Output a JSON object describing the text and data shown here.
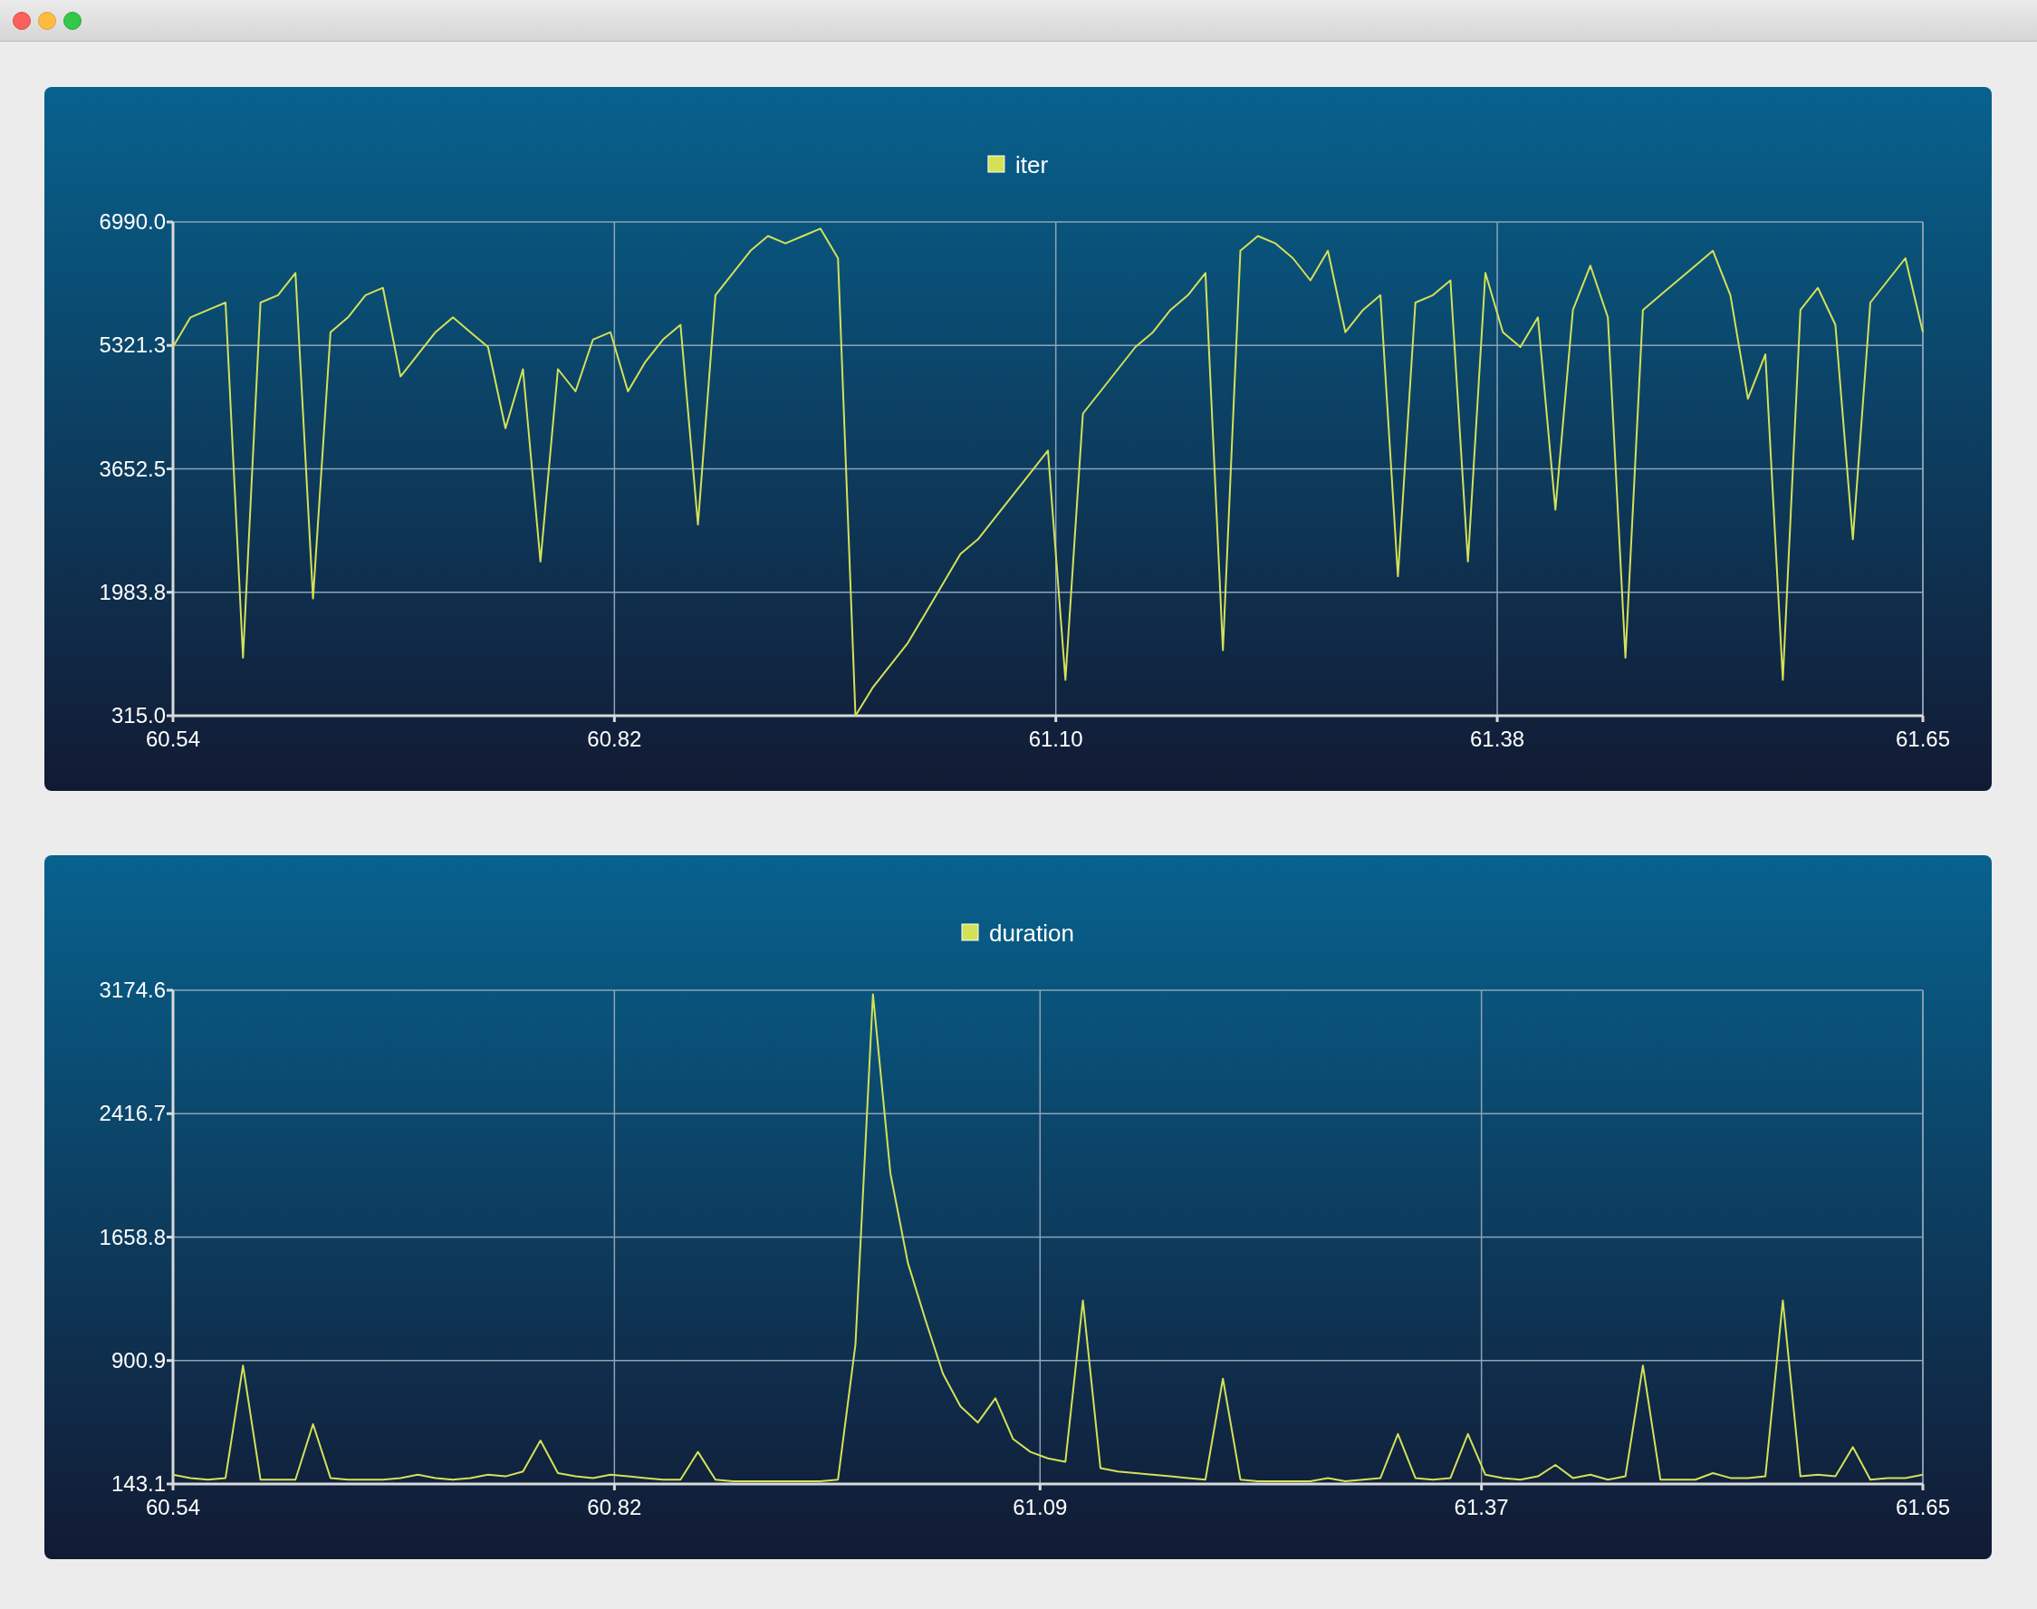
{
  "charts": [
    {
      "chart_data": {
        "type": "line",
        "grid": true,
        "x": [
          60.54,
          60.5511,
          60.5622,
          60.5733,
          60.5844,
          60.5955,
          60.6066,
          60.6177,
          60.6288,
          60.6399,
          60.651,
          60.6621,
          60.6732,
          60.6843,
          60.6954,
          60.7065,
          60.7176,
          60.7287,
          60.7398,
          60.7509,
          60.762,
          60.7731,
          60.7842,
          60.7953,
          60.8064,
          60.8175,
          60.8286,
          60.8397,
          60.8508,
          60.8619,
          60.873,
          60.8841,
          60.8952,
          60.9063,
          60.9174,
          60.9285,
          60.9396,
          60.9507,
          60.9618,
          60.9729,
          60.984,
          60.9951,
          61.0062,
          61.0173,
          61.0284,
          61.0395,
          61.0506,
          61.0617,
          61.0728,
          61.0839,
          61.095,
          61.1061,
          61.1172,
          61.1283,
          61.1394,
          61.1505,
          61.1616,
          61.1727,
          61.1838,
          61.1949,
          61.206,
          61.2171,
          61.2282,
          61.2393,
          61.2504,
          61.2615,
          61.2726,
          61.2837,
          61.2948,
          61.3059,
          61.317,
          61.3281,
          61.3392,
          61.3503,
          61.3614,
          61.3725,
          61.3836,
          61.3947,
          61.4058,
          61.4169,
          61.428,
          61.4391,
          61.4502,
          61.4613,
          61.4724,
          61.4835,
          61.4946,
          61.5057,
          61.5168,
          61.5279,
          61.539,
          61.5501,
          61.5612,
          61.5723,
          61.5834,
          61.5945,
          61.6056,
          61.6167,
          61.6278,
          61.6389,
          61.65
        ],
        "series": [
          {
            "name": "iter",
            "color": "#d4e157",
            "values": [
              5300,
              5700,
              5800,
              5900,
              1100,
              5900,
              6000,
              6300,
              1900,
              5500,
              5700,
              6000,
              6100,
              4900,
              5200,
              5500,
              5700,
              5500,
              5300,
              4200,
              5000,
              2400,
              5000,
              4700,
              5400,
              5500,
              4700,
              5100,
              5400,
              5600,
              2900,
              6000,
              6300,
              6600,
              6800,
              6700,
              6800,
              6900,
              6500,
              315,
              700,
              1000,
              1300,
              1700,
              2100,
              2500,
              2700,
              3000,
              3300,
              3600,
              3900,
              800,
              4400,
              4700,
              5000,
              5300,
              5500,
              5800,
              6000,
              6300,
              1200,
              6600,
              6800,
              6700,
              6500,
              6200,
              6600,
              5500,
              5800,
              6000,
              2200,
              5900,
              6000,
              6200,
              2400,
              6300,
              5500,
              5300,
              5700,
              3100,
              5800,
              6400,
              5700,
              1100,
              5800,
              6000,
              6200,
              6400,
              6600,
              6000,
              4600,
              5200,
              800,
              5800,
              6100,
              5600,
              2700,
              5900,
              6200,
              6500,
              5500
            ]
          }
        ],
        "xlim": [
          60.54,
          61.65
        ],
        "ylim": [
          315,
          6990
        ],
        "xticks": [
          {
            "value": 60.54,
            "label": "60.54"
          },
          {
            "value": 60.82,
            "label": "60.82"
          },
          {
            "value": 61.1,
            "label": "61.10"
          },
          {
            "value": 61.38,
            "label": "61.38"
          },
          {
            "value": 61.65,
            "label": "61.65"
          }
        ],
        "yticks": [
          {
            "value": 315,
            "label": "315.0"
          },
          {
            "value": 1983.8,
            "label": "1983.8"
          },
          {
            "value": 3652.5,
            "label": "3652.5"
          },
          {
            "value": 5321.3,
            "label": "5321.3"
          },
          {
            "value": 6990,
            "label": "6990.0"
          }
        ]
      }
    },
    {
      "chart_data": {
        "type": "line",
        "grid": true,
        "x": [
          60.54,
          60.5511,
          60.5622,
          60.5733,
          60.5844,
          60.5955,
          60.6066,
          60.6177,
          60.6288,
          60.6399,
          60.651,
          60.6621,
          60.6732,
          60.6843,
          60.6954,
          60.7065,
          60.7176,
          60.7287,
          60.7398,
          60.7509,
          60.762,
          60.7731,
          60.7842,
          60.7953,
          60.8064,
          60.8175,
          60.8286,
          60.8397,
          60.8508,
          60.8619,
          60.873,
          60.8841,
          60.8952,
          60.9063,
          60.9174,
          60.9285,
          60.9396,
          60.9507,
          60.9618,
          60.9729,
          60.984,
          60.9951,
          61.0062,
          61.0173,
          61.0284,
          61.0395,
          61.0506,
          61.0617,
          61.0728,
          61.0839,
          61.095,
          61.1061,
          61.1172,
          61.1283,
          61.1394,
          61.1505,
          61.1616,
          61.1727,
          61.1838,
          61.1949,
          61.206,
          61.2171,
          61.2282,
          61.2393,
          61.2504,
          61.2615,
          61.2726,
          61.2837,
          61.2948,
          61.3059,
          61.317,
          61.3281,
          61.3392,
          61.3503,
          61.3614,
          61.3725,
          61.3836,
          61.3947,
          61.4058,
          61.4169,
          61.428,
          61.4391,
          61.4502,
          61.4613,
          61.4724,
          61.4835,
          61.4946,
          61.5057,
          61.5168,
          61.5279,
          61.539,
          61.5501,
          61.5612,
          61.5723,
          61.5834,
          61.5945,
          61.6056,
          61.6167,
          61.6278,
          61.6389,
          61.65
        ],
        "series": [
          {
            "name": "duration",
            "color": "#d4e157",
            "values": [
              200,
              180,
              170,
              180,
              870,
              170,
              170,
              170,
              510,
              180,
              170,
              170,
              170,
              180,
              200,
              180,
              170,
              180,
              200,
              190,
              220,
              410,
              210,
              190,
              180,
              200,
              190,
              180,
              170,
              170,
              340,
              170,
              160,
              160,
              160,
              160,
              160,
              160,
              170,
              1000,
              3150,
              2050,
              1500,
              1150,
              820,
              620,
              520,
              670,
              420,
              340,
              300,
              280,
              1270,
              240,
              220,
              210,
              200,
              190,
              180,
              170,
              790,
              170,
              160,
              160,
              160,
              160,
              180,
              160,
              170,
              180,
              450,
              180,
              170,
              180,
              450,
              200,
              180,
              170,
              190,
              260,
              180,
              200,
              170,
              190,
              870,
              170,
              170,
              170,
              210,
              180,
              180,
              190,
              1270,
              190,
              200,
              190,
              370,
              170,
              180,
              180,
              200
            ]
          }
        ],
        "xlim": [
          60.54,
          61.65
        ],
        "ylim": [
          143.1,
          3174.6
        ],
        "xticks": [
          {
            "value": 60.54,
            "label": "60.54"
          },
          {
            "value": 60.82,
            "label": "60.82"
          },
          {
            "value": 61.09,
            "label": "61.09"
          },
          {
            "value": 61.37,
            "label": "61.37"
          },
          {
            "value": 61.65,
            "label": "61.65"
          }
        ],
        "yticks": [
          {
            "value": 143.1,
            "label": "143.1"
          },
          {
            "value": 900.9,
            "label": "900.9"
          },
          {
            "value": 1658.8,
            "label": "1658.8"
          },
          {
            "value": 2416.7,
            "label": "2416.7"
          },
          {
            "value": 3174.6,
            "label": "3174.6"
          }
        ]
      }
    }
  ]
}
